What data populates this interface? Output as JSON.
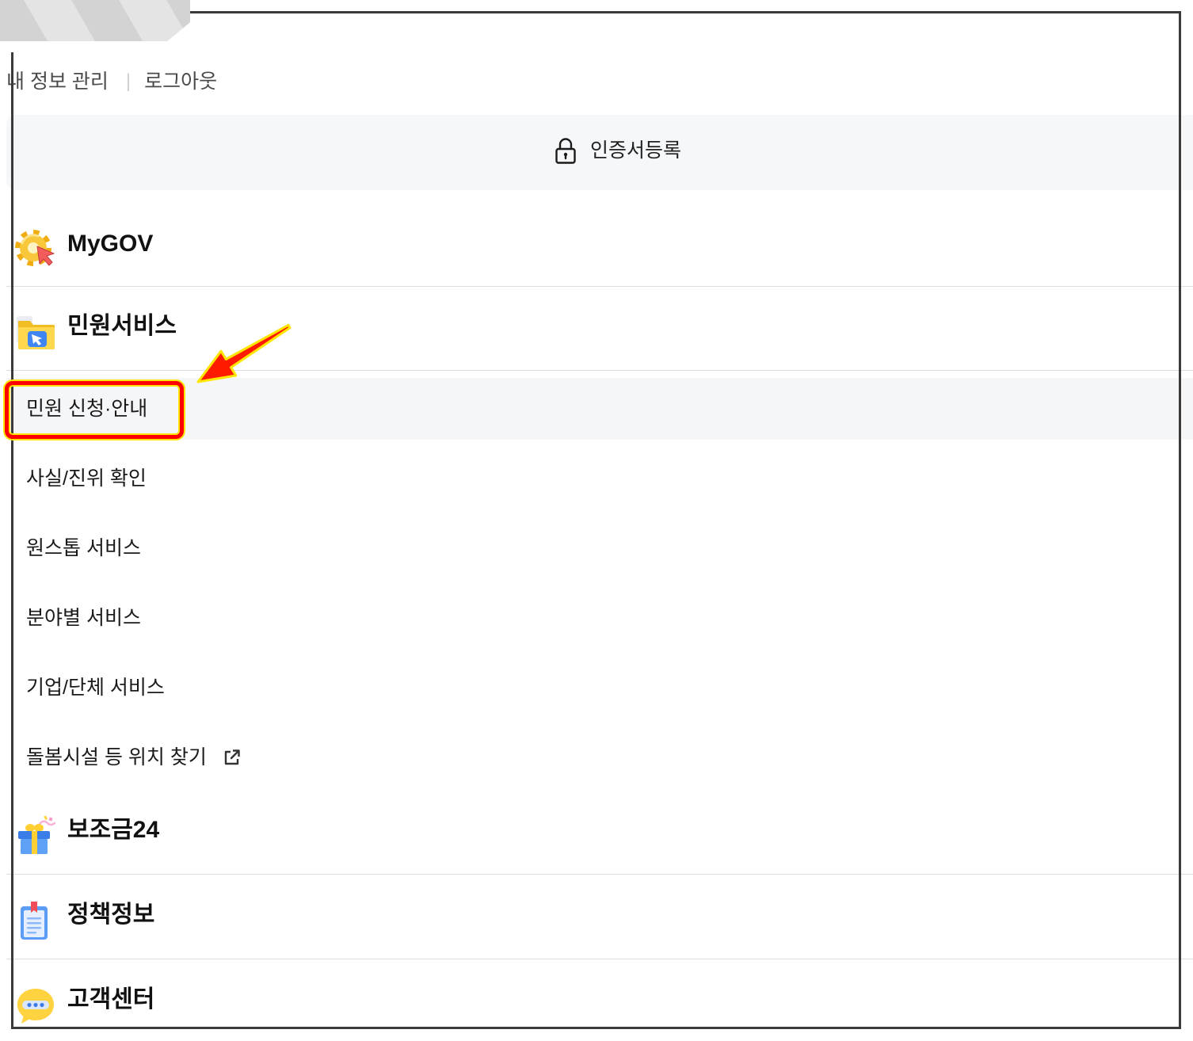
{
  "top_links": {
    "my_info": "내 정보 관리",
    "separator": "|",
    "logout": "로그아웃"
  },
  "cert_button": {
    "label": "인증서등록",
    "icon": "lock-icon"
  },
  "menu": {
    "mygov": {
      "title": "MyGOV",
      "icon": "gear-cursor-icon"
    },
    "civil": {
      "title": "민원서비스",
      "icon": "folder-cursor-icon",
      "items": [
        {
          "label": "민원 신청·안내",
          "active": true
        },
        {
          "label": "사실/진위 확인"
        },
        {
          "label": "원스톱 서비스"
        },
        {
          "label": "분야별 서비스"
        },
        {
          "label": "기업/단체 서비스"
        },
        {
          "label": "돌봄시설 등 위치 찾기",
          "external": true,
          "icon": "external-link-icon"
        }
      ]
    },
    "subsidy": {
      "title": "보조금24",
      "icon": "gift-box-icon"
    },
    "policy": {
      "title": "정책정보",
      "icon": "clipboard-icon"
    },
    "support": {
      "title": "고객센터",
      "icon": "chat-bubble-icon"
    }
  },
  "theme": {
    "active_bg": "#f5f6f8",
    "cert_bg": "#f6f7f9",
    "divider": "#dadde2"
  },
  "annotation": {
    "highlight_color": "#ff0000",
    "outline_color": "#ffe600",
    "arrow_color": "#ff1a00",
    "frame_color": "#3a3a3a"
  }
}
